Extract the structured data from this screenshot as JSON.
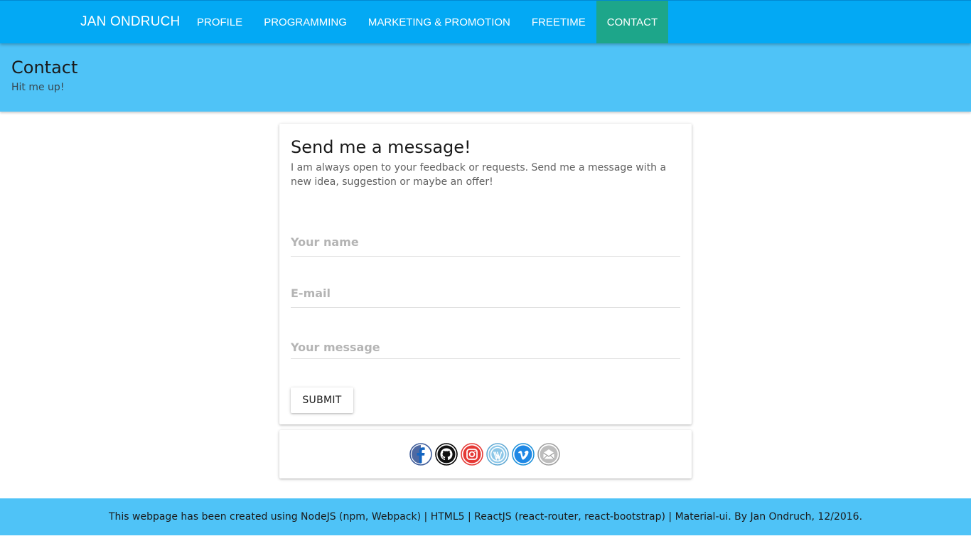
{
  "navbar": {
    "brand": "JAN ONDRUCH",
    "items": [
      {
        "label": "PROFILE",
        "active": false
      },
      {
        "label": "PROGRAMMING",
        "active": false
      },
      {
        "label": "MARKETING & PROMOTION",
        "active": false
      },
      {
        "label": "FREETIME",
        "active": false
      },
      {
        "label": "CONTACT",
        "active": true
      }
    ]
  },
  "header": {
    "title": "Contact",
    "subtitle": "Hit me up!"
  },
  "contact_form": {
    "title": "Send me a message!",
    "description": "I am always open to your feedback or requests. Send me a message with a new idea, suggestion or maybe an offer!",
    "name_placeholder": "Your name",
    "email_placeholder": "E-mail",
    "message_placeholder": "Your message",
    "submit_label": "SUBMIT"
  },
  "social": [
    {
      "icon": "facebook-icon",
      "color": "#3b5998"
    },
    {
      "icon": "github-icon",
      "color": "#000000"
    },
    {
      "icon": "instagram-icon",
      "color": "#e4405f"
    },
    {
      "icon": "wordpress-icon",
      "color": "#5fa8d3"
    },
    {
      "icon": "vimeo-icon",
      "color": "#1ab7ea"
    },
    {
      "icon": "email-icon",
      "color": "#9e9e9e"
    }
  ],
  "footer": {
    "text": "This webpage has been created using NodeJS (npm, Webpack) | HTML5 | ReactJS (react-router, react-bootstrap) | Material-ui. By Jan Ondruch, 12/2016."
  },
  "colors": {
    "navbar": "#03a9f4",
    "nav_active": "#1da68a",
    "header_band": "#4fc3f7",
    "footer": "#4fc3f7"
  }
}
